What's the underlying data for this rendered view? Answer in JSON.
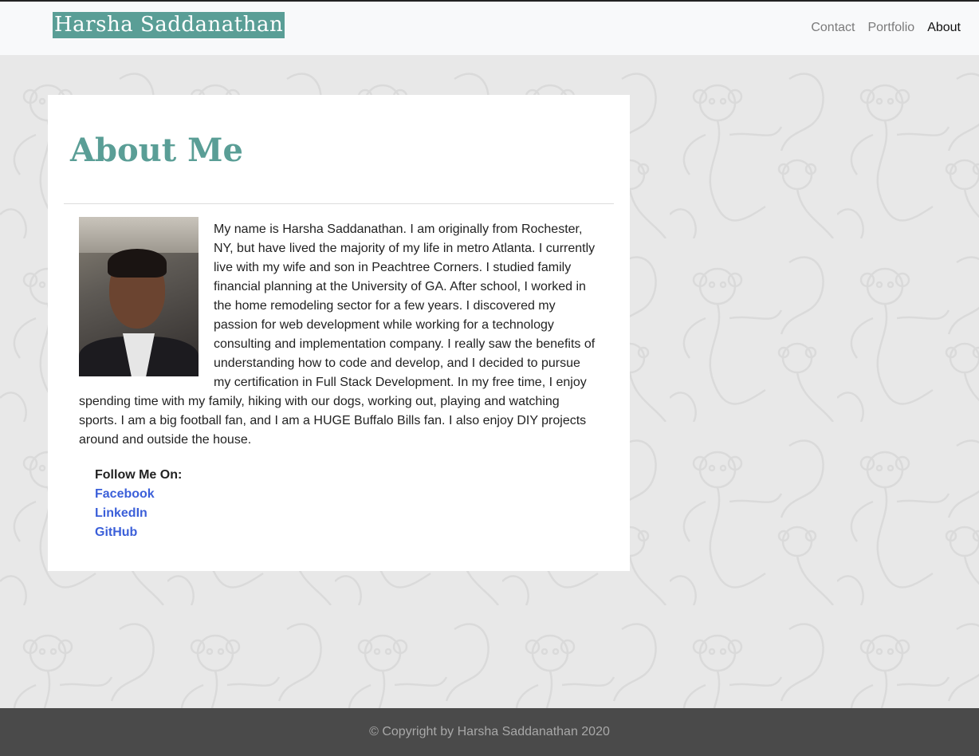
{
  "header": {
    "brand": "Harsha Saddanathan",
    "nav": [
      {
        "label": "Contact",
        "active": false
      },
      {
        "label": "Portfolio",
        "active": false
      },
      {
        "label": "About",
        "active": true
      }
    ]
  },
  "main": {
    "title": "About Me",
    "bio": "My name is Harsha Saddanathan. I am originally from Rochester, NY, but have lived the majority of my life in metro Atlanta. I currently live with my wife and son in Peachtree Corners. I studied family financial planning at the University of GA. After school, I worked in the home remodeling sector for a few years. I discovered my passion for web development while working for a technology consulting and implementation company. I really saw the benefits of understanding how to code and develop, and I decided to pursue my certification in Full Stack Development. In my free time, I enjoy spending time with my family, hiking with our dogs, working out, playing and watching sports. I am a big football fan, and I am a HUGE Buffalo Bills fan. I also enjoy DIY projects around and outside the house.",
    "follow_label": "Follow Me On:",
    "social": [
      "Facebook",
      "LinkedIn",
      "GitHub"
    ]
  },
  "footer": {
    "copyright": "© Copyright by Harsha Saddanathan 2020"
  },
  "colors": {
    "accent": "#5a9e96",
    "link": "#3b5fd9",
    "footer_bg": "#4a4a4a"
  }
}
